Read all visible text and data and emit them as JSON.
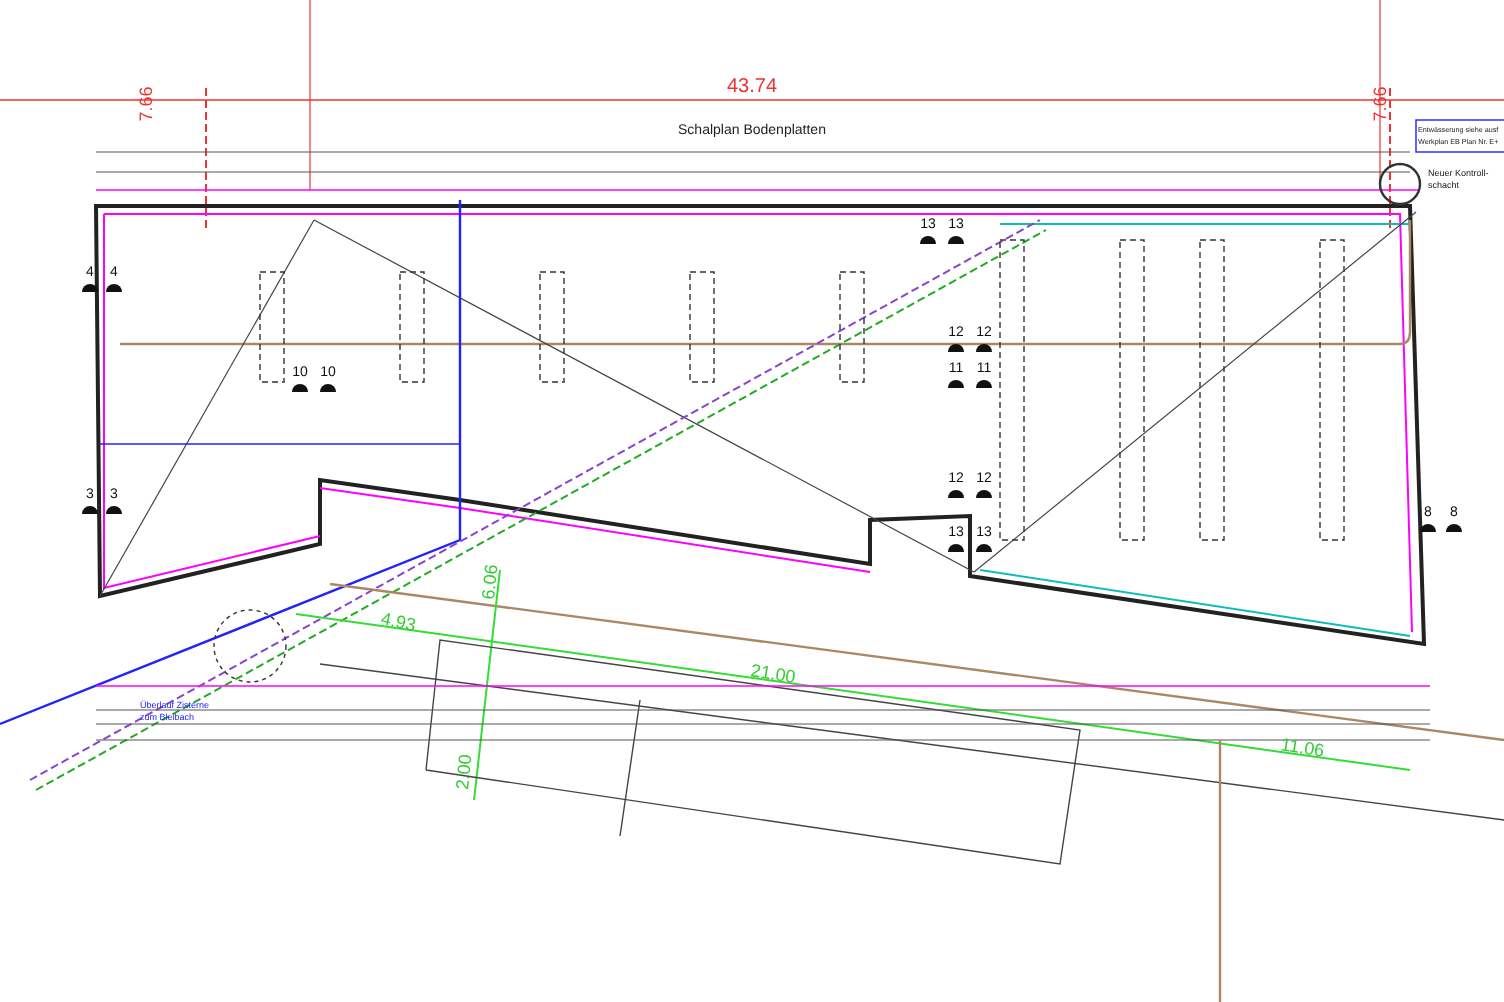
{
  "drawing": {
    "title": "Schalplan Bodenplatten",
    "overall_dimension": "43.74",
    "height_dimensions": [
      "7.66",
      "7.66"
    ],
    "drainage_note": [
      "Entwässerung siehe ausf",
      "Werkplan EB Plan Nr. E+"
    ],
    "shaft_label": [
      "Neuer Kontroll-",
      "schacht"
    ],
    "overflow_note": [
      "Überlauf Zisterne",
      "zum Bleibach"
    ],
    "green_dimensions": [
      "4.93",
      "21.00",
      "11.06",
      "6.06",
      "2.00"
    ],
    "section_markers": [
      {
        "number": "4"
      },
      {
        "number": "4"
      },
      {
        "number": "3"
      },
      {
        "number": "3"
      },
      {
        "number": "10"
      },
      {
        "number": "10"
      },
      {
        "number": "13"
      },
      {
        "number": "13"
      },
      {
        "number": "12"
      },
      {
        "number": "12"
      },
      {
        "number": "11"
      },
      {
        "number": "11"
      },
      {
        "number": "12"
      },
      {
        "number": "12"
      },
      {
        "number": "13"
      },
      {
        "number": "13"
      },
      {
        "number": "8"
      },
      {
        "number": "8"
      }
    ]
  }
}
